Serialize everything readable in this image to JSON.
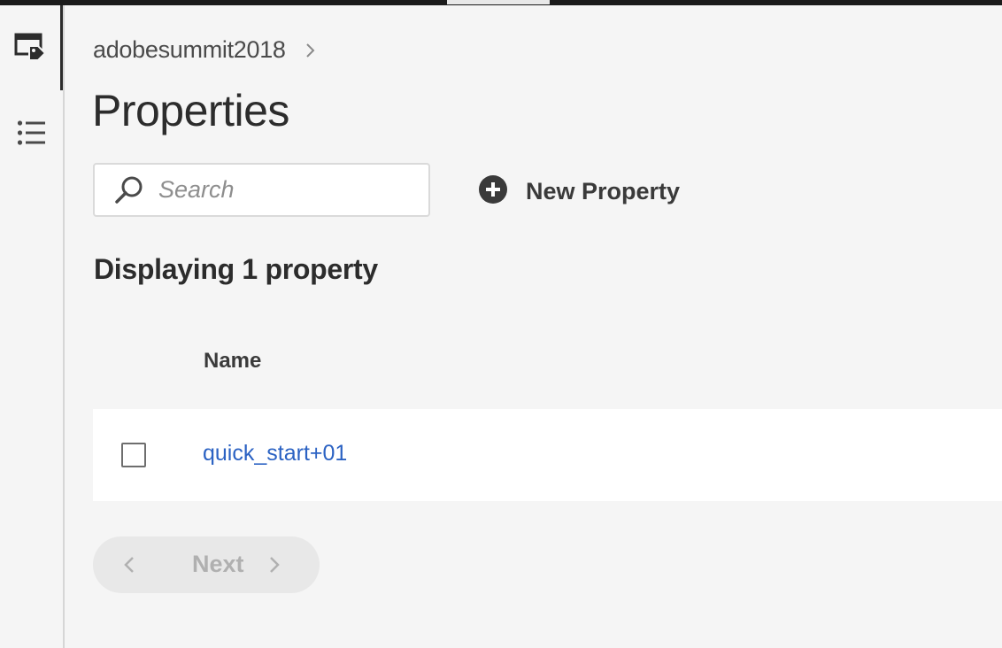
{
  "rail": {
    "items": [
      {
        "icon": "property-tag-icon",
        "selected": true
      },
      {
        "icon": "list-icon",
        "selected": false
      }
    ]
  },
  "breadcrumb": {
    "company": "adobesummit2018"
  },
  "page": {
    "title": "Properties"
  },
  "search": {
    "placeholder": "Search",
    "value": ""
  },
  "actions": {
    "new_property_label": "New Property"
  },
  "summary": {
    "count_text": "Displaying 1 property"
  },
  "table": {
    "columns": [
      "Name"
    ],
    "rows": [
      {
        "name": "quick_start+01",
        "checked": false
      }
    ]
  },
  "pagination": {
    "next_label": "Next",
    "enabled": false
  },
  "colors": {
    "link": "#2b62c3",
    "background": "#f5f5f5",
    "topbar": "#1b1b1b"
  }
}
